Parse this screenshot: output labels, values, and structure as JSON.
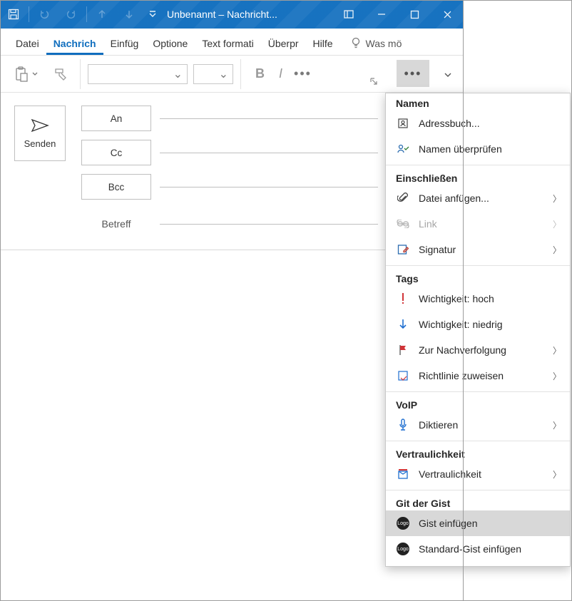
{
  "titlebar": {
    "title": "Unbenannt – Nachricht..."
  },
  "tabs": {
    "items": [
      "Datei",
      "Nachrich",
      "Einfüg",
      "Optione",
      "Text formati",
      "Überpr",
      "Hilfe"
    ],
    "active_index": 1,
    "hint": "Was mö"
  },
  "compose": {
    "send": "Senden",
    "to": "An",
    "cc": "Cc",
    "bcc": "Bcc",
    "subject_label": "Betreff"
  },
  "panel": {
    "sections": [
      {
        "title": "Namen",
        "items": [
          {
            "icon": "addressbook",
            "label": "Adressbuch...",
            "submenu": false
          },
          {
            "icon": "checknames",
            "label": "Namen überprüfen",
            "submenu": false
          }
        ]
      },
      {
        "title": "Einschließen",
        "items": [
          {
            "icon": "attach",
            "label": "Datei anfügen...",
            "submenu": true
          },
          {
            "icon": "link",
            "label": "Link",
            "submenu": true,
            "disabled": true
          },
          {
            "icon": "signature",
            "label": "Signatur",
            "submenu": true
          }
        ]
      },
      {
        "title": "Tags",
        "items": [
          {
            "icon": "imp-high",
            "label": "Wichtigkeit: hoch",
            "submenu": false
          },
          {
            "icon": "imp-low",
            "label": "Wichtigkeit: niedrig",
            "submenu": false
          },
          {
            "icon": "flag",
            "label": "Zur Nachverfolgung",
            "submenu": true
          },
          {
            "icon": "policy",
            "label": "Richtlinie zuweisen",
            "submenu": true
          }
        ]
      },
      {
        "title": "VoIP",
        "items": [
          {
            "icon": "mic",
            "label": "Diktieren",
            "submenu": true
          }
        ]
      },
      {
        "title": "Vertraulichkeit",
        "items": [
          {
            "icon": "sensitivity",
            "label": "Vertraulichkeit",
            "submenu": true
          }
        ]
      },
      {
        "title": "Git der Gist",
        "items": [
          {
            "icon": "logo",
            "label": "Gist einfügen",
            "submenu": false,
            "hover": true
          },
          {
            "icon": "logo",
            "label": "Standard-Gist einfügen",
            "submenu": false
          }
        ]
      }
    ]
  }
}
